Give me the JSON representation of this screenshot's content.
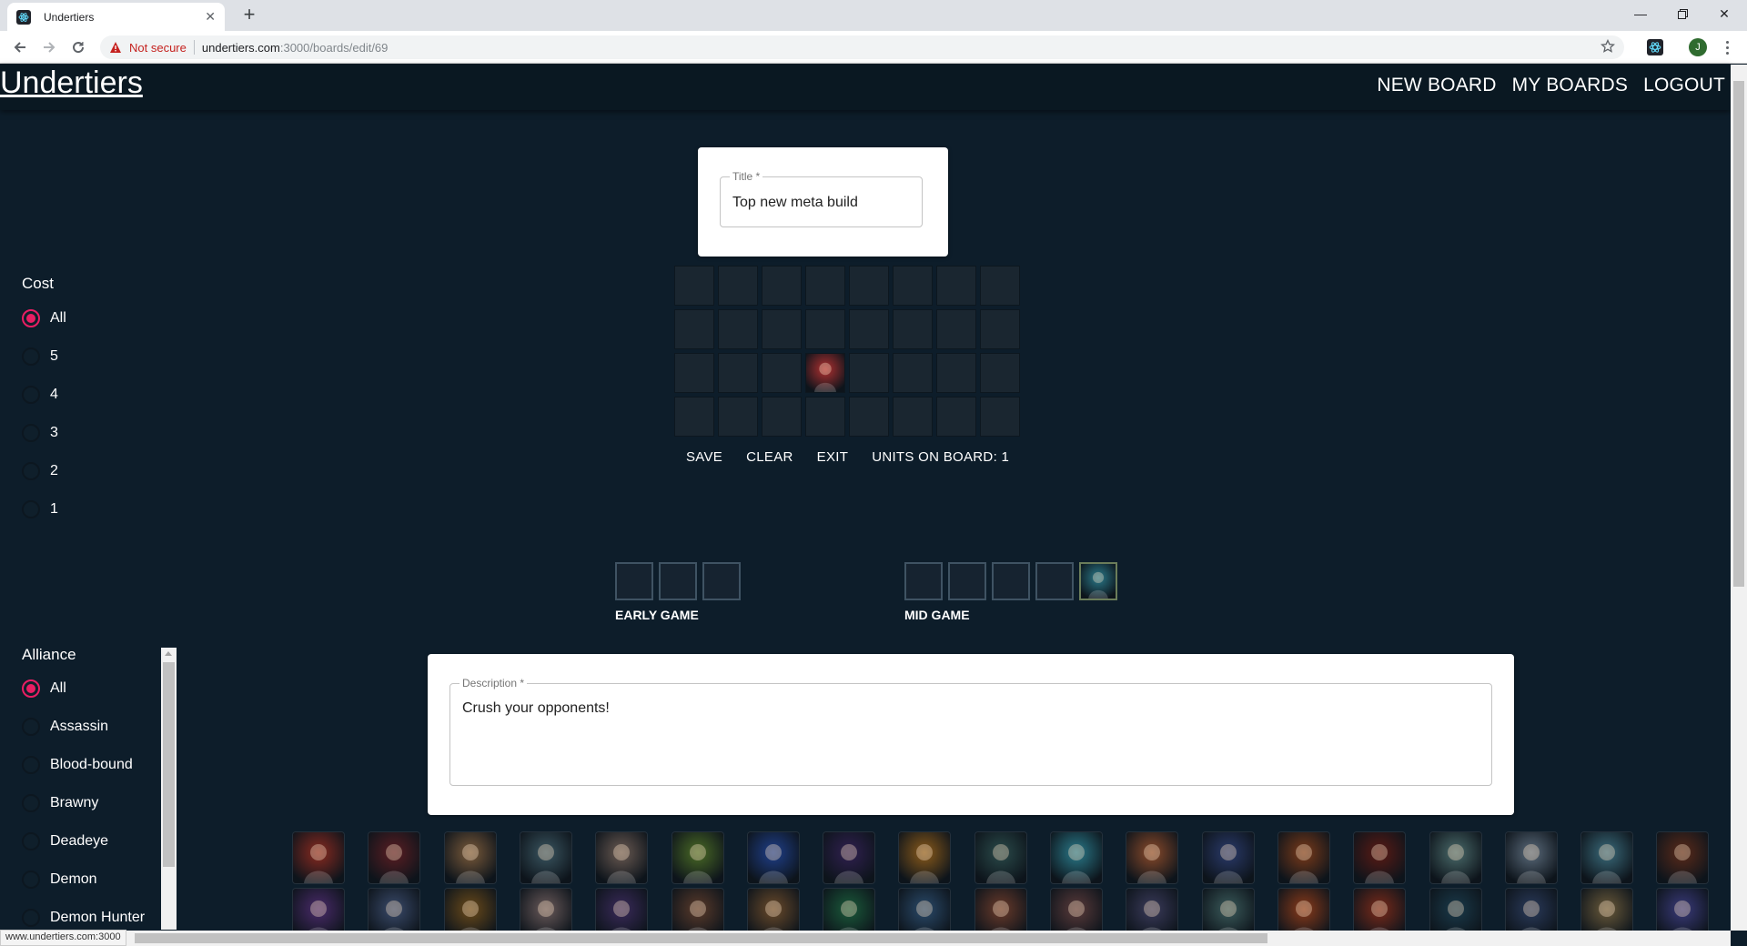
{
  "browser": {
    "tab_title": "Undertiers",
    "not_secure_label": "Not secure",
    "url_host": "undertiers.com",
    "url_path": ":3000/boards/edit/69",
    "profile_initial": "J",
    "status_url": "www.undertiers.com:3000"
  },
  "header": {
    "brand": "Undertiers",
    "nav": [
      "NEW BOARD",
      "MY BOARDS",
      "LOGOUT"
    ]
  },
  "cost_filter": {
    "title": "Cost",
    "options": [
      "All",
      "5",
      "4",
      "3",
      "2",
      "1"
    ],
    "selected": "All"
  },
  "alliance_filter": {
    "title": "Alliance",
    "options": [
      "All",
      "Assassin",
      "Blood-bound",
      "Brawny",
      "Deadeye",
      "Demon",
      "Demon Hunter"
    ],
    "selected": "All"
  },
  "title_field": {
    "label": "Title *",
    "value": "Top new meta build"
  },
  "board": {
    "rows": 4,
    "cols": 8,
    "filled_cells": [
      [
        2,
        3
      ]
    ],
    "actions": [
      "SAVE",
      "CLEAR",
      "EXIT"
    ],
    "units_label": "UNITS ON BOARD: 1"
  },
  "early_game": {
    "label": "EARLY GAME",
    "slot_count": 3,
    "filled_slots": []
  },
  "mid_game": {
    "label": "MID GAME",
    "slot_count": 5,
    "filled_slots": [
      4
    ]
  },
  "description_field": {
    "label": "Description *",
    "value": "Crush your opponents!"
  },
  "unit_pool": {
    "row1_colors": [
      "#8a2a20",
      "#5a1d22",
      "#7a5a3a",
      "#3a5560",
      "#6a5a52",
      "#4a6a25",
      "#1f3f8a",
      "#302050",
      "#8a5a1a",
      "#2a4a4a",
      "#2a7a8a",
      "#8a4a2a",
      "#2a3a6a",
      "#7a3a1a",
      "#5a1a14",
      "#4a6a6a",
      "#5a6a7a",
      "#3a6a7a",
      "#5a2a1a"
    ],
    "row2_colors": [
      "#4a2a6a",
      "#3a4a6a",
      "#6a4a1a",
      "#6a5a5a",
      "#3a2a5a",
      "#5a3a2a",
      "#6a4a2a",
      "#1a5a3a",
      "#2a4a6a",
      "#6a3a2a",
      "#5a3a3a",
      "#3a3a5a",
      "#3a5a5a",
      "#8a3a1a",
      "#7a2a1a",
      "#1a3a4a",
      "#2a3a5a",
      "#6a5a3a",
      "#3a3a7a"
    ]
  }
}
